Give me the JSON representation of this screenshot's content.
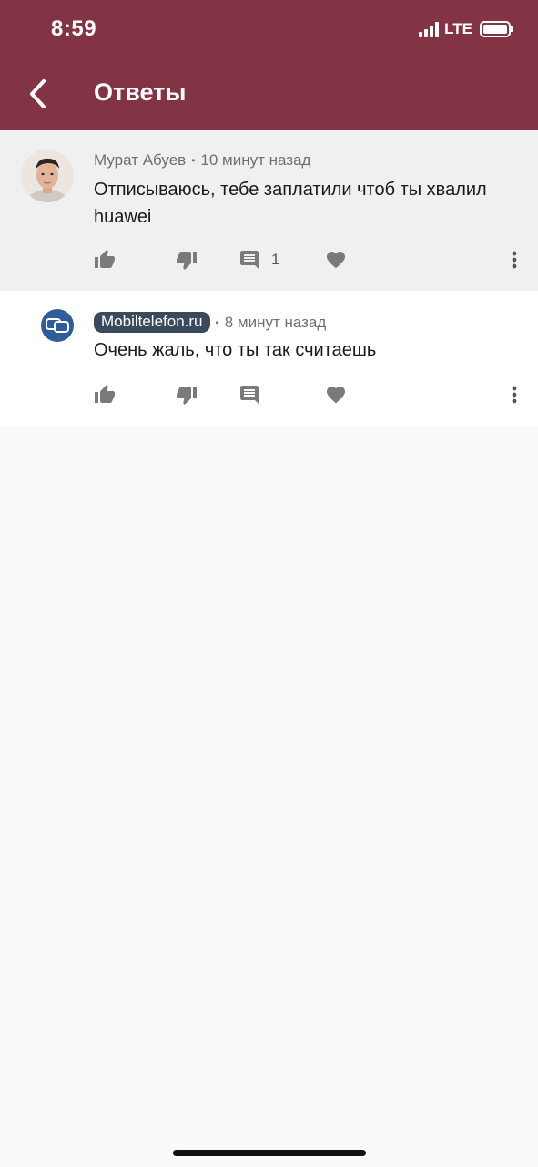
{
  "status_bar": {
    "time": "8:59",
    "network": "LTE"
  },
  "header": {
    "title": "Ответы",
    "back_icon": "chevron-left-icon"
  },
  "colors": {
    "header_bg": "#823445",
    "badge_bg": "#3a4a5c",
    "avatar_brand": "#2f5d99"
  },
  "comments": [
    {
      "author": "Мурат Абуев",
      "time": "10 минут назад",
      "text": "Отписываюсь, тебе заплатили чтоб ты хвалил huawei",
      "reply_count": "1"
    },
    {
      "author": "Mobiltelefon.ru",
      "time": "8 минут назад",
      "text": "Очень жаль, что ты так считаешь",
      "reply_count": ""
    }
  ],
  "icons": [
    "thumb-up-icon",
    "thumb-down-icon",
    "comment-icon",
    "heart-icon",
    "more-vertical-icon"
  ]
}
